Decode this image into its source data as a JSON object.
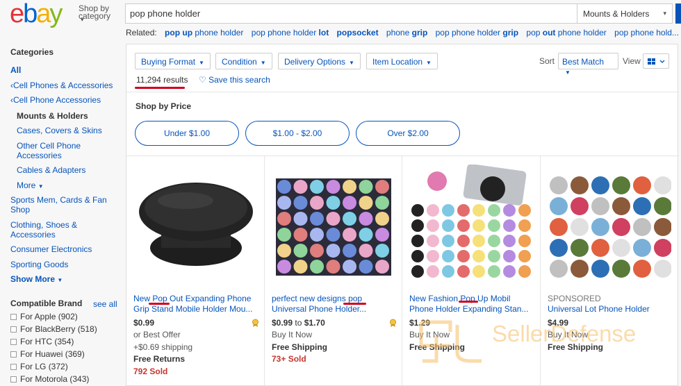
{
  "header": {
    "logo_letters": [
      "e",
      "b",
      "a",
      "y"
    ],
    "shop_by_line1": "Shop by",
    "shop_by_line2": "category",
    "search_value": "pop phone holder",
    "category_select": "Mounts & Holders"
  },
  "related": {
    "label": "Related:",
    "items": [
      {
        "bold": "pop up",
        "rest": " phone holder"
      },
      {
        "pre": "pop phone holder ",
        "bold": "lot"
      },
      {
        "bold": "popsocket"
      },
      {
        "pre": "phone ",
        "bold": "grip"
      },
      {
        "pre": "pop phone holder ",
        "bold": "grip"
      },
      {
        "pre": "pop ",
        "bold": "out",
        "rest": " phone holder"
      },
      {
        "pre": "pop phone hold..."
      }
    ]
  },
  "sidebar": {
    "categories_title": "Categories",
    "all": "All",
    "cat_cell_phones": "Cell Phones & Accessories",
    "cat_cell_acc": "Cell Phone Accessories",
    "current": "Mounts & Holders",
    "sub_cases": "Cases, Covers & Skins",
    "sub_other_1": "Other Cell Phone",
    "sub_other_2": "Accessories",
    "sub_cables": "Cables & Adapters",
    "more": "More",
    "sports_1": "Sports Mem, Cards & Fan",
    "sports_2": "Shop",
    "clothing_1": "Clothing, Shoes &",
    "clothing_2": "Accessories",
    "consumer": "Consumer Electronics",
    "sporting": "Sporting Goods",
    "show_more": "Show More",
    "brand_title": "Compatible Brand",
    "see_all": "see all",
    "brands": [
      {
        "name": "For Apple",
        "count": "(902)"
      },
      {
        "name": "For BlackBerry",
        "count": "(518)"
      },
      {
        "name": "For HTC",
        "count": "(354)"
      },
      {
        "name": "For Huawei",
        "count": "(369)"
      },
      {
        "name": "For LG",
        "count": "(372)"
      },
      {
        "name": "For Motorola",
        "count": "(343)"
      }
    ]
  },
  "filters": {
    "buying_format": "Buying Format",
    "condition": "Condition",
    "delivery": "Delivery Options",
    "location": "Item Location",
    "sort_label": "Sort",
    "sort_value": "Best Match",
    "view_label": "View"
  },
  "results": {
    "count": "11,294 results",
    "save": "Save this search"
  },
  "shop_by_price": {
    "title": "Shop by Price",
    "pills": [
      "Under $1.00",
      "$1.00 - $2.00",
      "Over $2.00"
    ]
  },
  "products": [
    {
      "title_1": "New Pop Out Expanding Phone",
      "title_2": "Grip Stand Mobile Holder Mou...",
      "price": "$0.99",
      "line1": "or Best Offer",
      "line2": "+$0.69 shipping",
      "bold": "Free Returns",
      "sold": "792 Sold"
    },
    {
      "title_1": "perfect new designs pop",
      "title_2": "Universal Phone Holder...",
      "price_from": "$0.99",
      "price_to_word": "to",
      "price_to": "$1.70",
      "line1": "Buy It Now",
      "bold": "Free Shipping",
      "sold": "73+ Sold"
    },
    {
      "title_1": "New Fashion Pop Up Mobil",
      "title_2": "Phone Holder Expanding Stan...",
      "price": "$1.29",
      "line1": "Buy It Now",
      "bold": "Free Shipping"
    },
    {
      "sponsored": "SPONSORED",
      "title_1": "Universal Lot Phone Holder",
      "price": "$4.99",
      "line1": "Buy It Now",
      "bold": "Free Shipping"
    }
  ],
  "watermark": {
    "text": "SellerDefense"
  },
  "colors": {
    "link": "#0654ba",
    "accent_red": "#d0021b",
    "sold_red": "#c6352f"
  }
}
